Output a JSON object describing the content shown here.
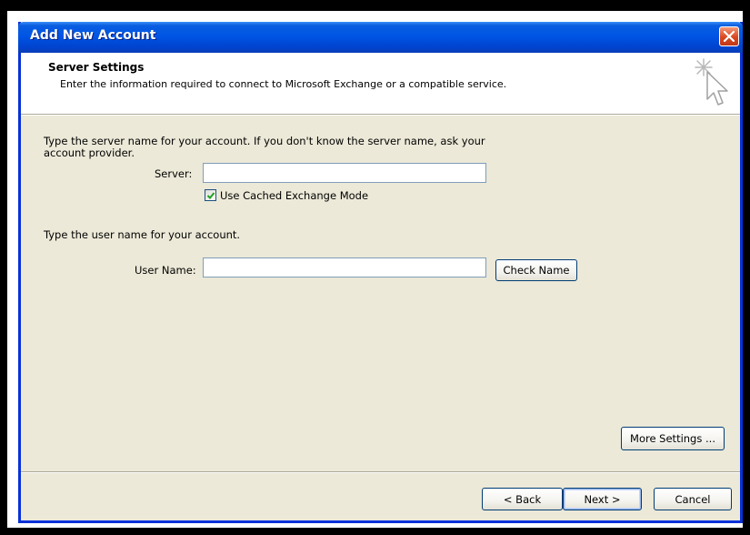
{
  "window": {
    "title": "Add New Account"
  },
  "header": {
    "title": "Server Settings",
    "description": "Enter the information required to connect to Microsoft Exchange or a compatible service."
  },
  "server_section": {
    "instruction_line1": "Type the server name for your account. If you don't know the server name, ask your",
    "instruction_line2": "account provider.",
    "server_label": "Server:",
    "server_value": "",
    "cached_mode_label": "Use Cached Exchange Mode",
    "cached_mode_checked": true
  },
  "user_section": {
    "instruction": "Type the user name for your account.",
    "user_name_label": "User Name:",
    "user_name_value": "",
    "check_name_button": "Check Name"
  },
  "buttons": {
    "more_settings": "More Settings ...",
    "back": "< Back",
    "next": "Next >",
    "cancel": "Cancel"
  },
  "icons": {
    "close": "close-icon",
    "header": "sparkle-cursor-icon",
    "checkbox": "checkmark-icon"
  },
  "colors": {
    "titlebar": "#0055e5",
    "dialog_background": "#ece9d8",
    "close_button": "#d9471f",
    "checkmark": "#21a121"
  }
}
